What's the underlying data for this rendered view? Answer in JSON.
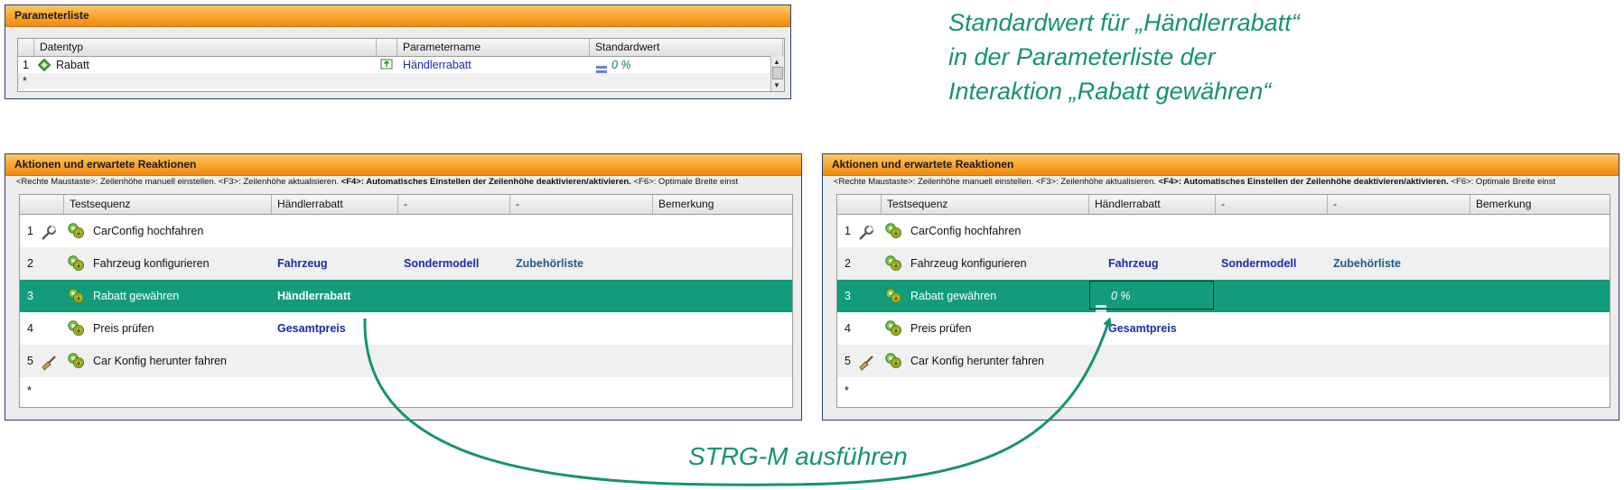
{
  "param_panel": {
    "title": "Parameterliste",
    "columns": [
      "Datentyp",
      "",
      "Parametername",
      "Standardwert"
    ],
    "rows": [
      {
        "num": "1",
        "datatype": "Rabatt",
        "name": "Händlerrabatt",
        "value": "0 %"
      }
    ],
    "new_row_marker": "*"
  },
  "annotation_top": {
    "line1": "Standardwert für „Händlerrabatt“",
    "line2": "in der Parameterliste der",
    "line3": "Interaktion „Rabatt gewähren“"
  },
  "annotation_bottom": "STRG-M ausführen",
  "actions_left": {
    "title": "Aktionen und erwartete Reaktionen",
    "hint_a": "<Rechte Maustaste>: Zeilenhöhe manuell einstellen. <F3>: Zeilenhöhe aktualisieren. ",
    "hint_b": "<F4>: Automatisches Einstellen der Zeilenhöhe deaktivieren/aktivieren.",
    "hint_c": " <F6>: Optimale Breite einst",
    "columns": [
      "Testsequenz",
      "Händlerrabatt",
      "-",
      "-",
      "Bemerkung"
    ],
    "rows": [
      {
        "num": "1",
        "step": "CarConfig hochfahren",
        "c1": "",
        "c2": "",
        "c3": ""
      },
      {
        "num": "2",
        "step": "Fahrzeug konfigurieren",
        "c1": "Fahrzeug",
        "c2": "Sondermodell",
        "c3": "Zubehörliste"
      },
      {
        "num": "3",
        "step": "Rabatt gewähren",
        "c1": "Händlerrabatt",
        "c2": "",
        "c3": ""
      },
      {
        "num": "4",
        "step": "Preis prüfen",
        "c1": "Gesamtpreis",
        "c2": "",
        "c3": ""
      },
      {
        "num": "5",
        "step": "Car Konfig herunter fahren",
        "c1": "",
        "c2": "",
        "c3": ""
      }
    ],
    "new_row_marker": "*"
  },
  "actions_right": {
    "title": "Aktionen und erwartete Reaktionen",
    "hint_a": "<Rechte Maustaste>: Zeilenhöhe manuell einstellen. <F3>: Zeilenhöhe aktualisieren. ",
    "hint_b": "<F4>: Automatisches Einstellen der Zeilenhöhe deaktivieren/aktivieren.",
    "hint_c": " <F6>: Optimale Breite einst",
    "columns": [
      "Testsequenz",
      "Händlerrabatt",
      "-",
      "-",
      "Bemerkung"
    ],
    "rows": [
      {
        "num": "1",
        "step": "CarConfig hochfahren",
        "c1": "",
        "c2": "",
        "c3": ""
      },
      {
        "num": "2",
        "step": "Fahrzeug konfigurieren",
        "c1": "Fahrzeug",
        "c2": "Sondermodell",
        "c3": "Zubehörliste"
      },
      {
        "num": "3",
        "step": "Rabatt gewähren",
        "c1": "0 %",
        "c2": "",
        "c3": ""
      },
      {
        "num": "4",
        "step": "Preis prüfen",
        "c1": "Gesamtpreis",
        "c2": "",
        "c3": ""
      },
      {
        "num": "5",
        "step": "Car Konfig herunter fahren",
        "c1": "",
        "c2": "",
        "c3": ""
      }
    ],
    "new_row_marker": "*"
  },
  "colors": {
    "accent": "#16936e",
    "selected_row": "#129c7b",
    "title_bar": "#f7a02a",
    "link": "#1a2aa8"
  }
}
